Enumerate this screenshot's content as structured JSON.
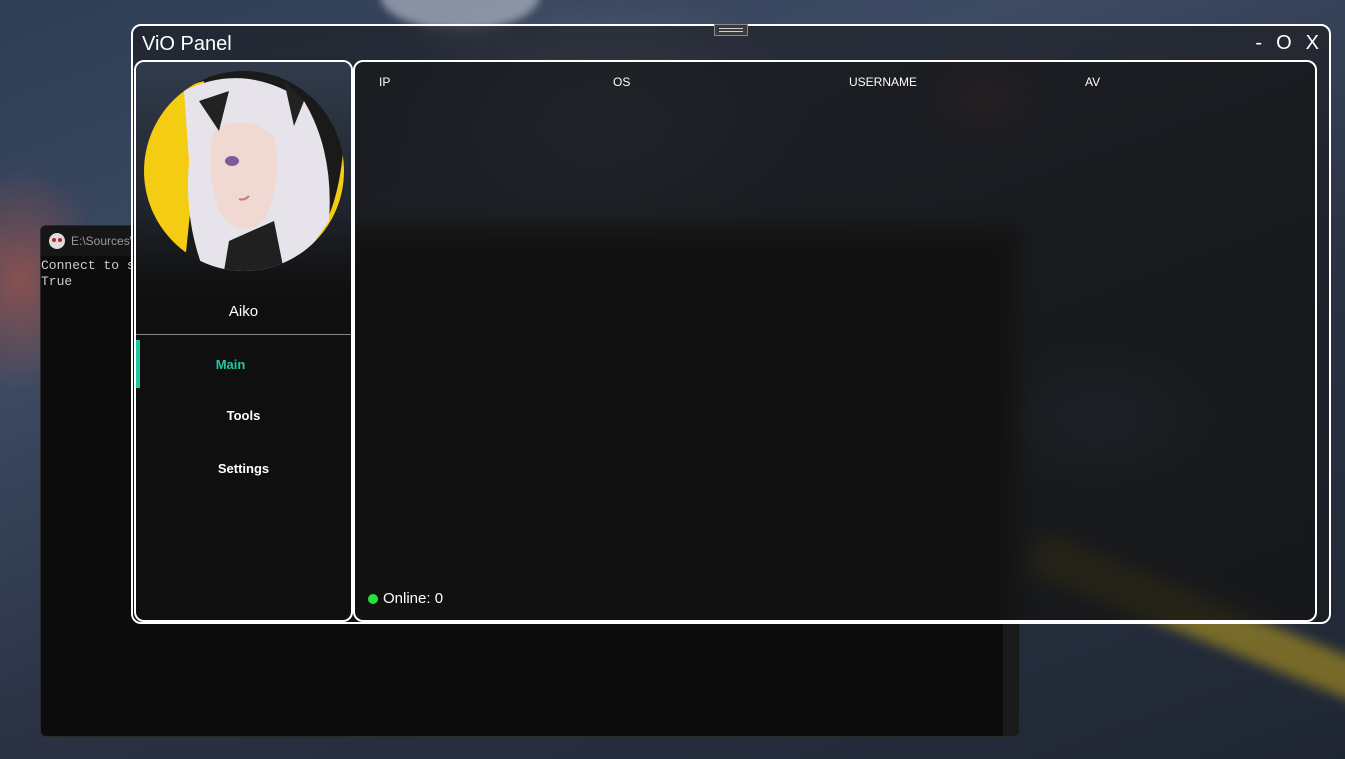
{
  "console": {
    "title": "E:\\Sources\\",
    "lines": [
      "Connect to s",
      "True"
    ]
  },
  "panel": {
    "title": "ViO Panel",
    "controls": {
      "minimize": "-",
      "maximize": "O",
      "close": "X"
    }
  },
  "sidebar": {
    "profile_name": "Aiko",
    "items": [
      {
        "label": "Main",
        "active": true
      },
      {
        "label": "Tools",
        "active": false
      },
      {
        "label": "Settings",
        "active": false
      }
    ]
  },
  "table": {
    "columns": [
      "IP",
      "OS",
      "USERNAME",
      "AV"
    ],
    "rows": []
  },
  "status": {
    "text": "Online: 0",
    "dot_color": "#22e43a"
  },
  "colors": {
    "accent": "#1ec8a0",
    "border": "#ffffff"
  }
}
